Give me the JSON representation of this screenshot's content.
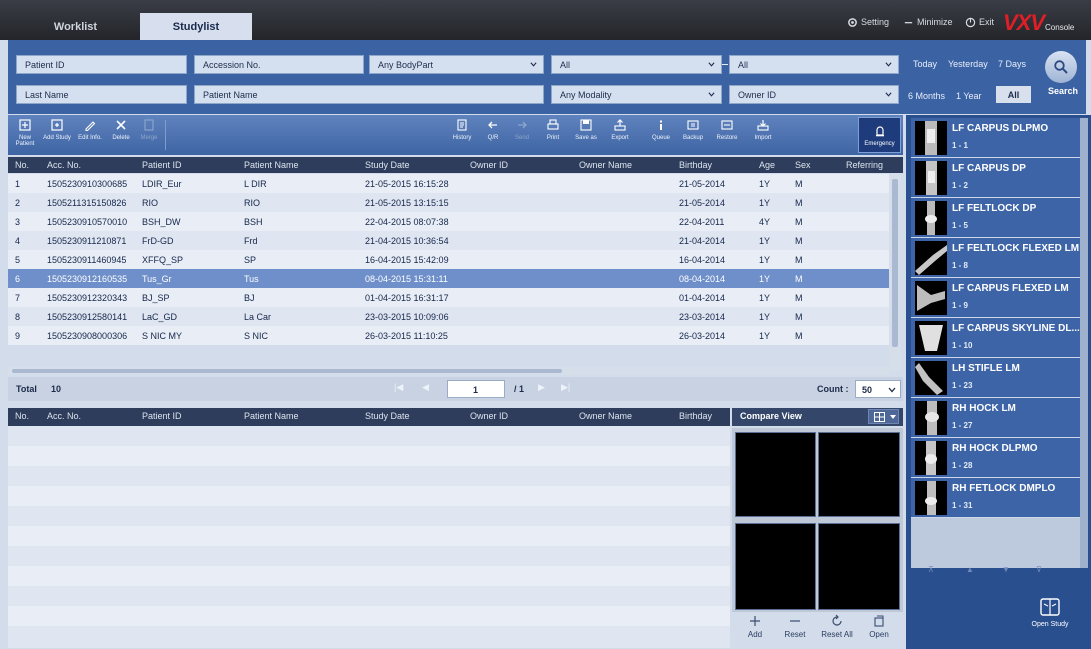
{
  "tabs": {
    "worklist": "Worklist",
    "studylist": "Studylist"
  },
  "topbar": {
    "setting": "Setting",
    "minimize": "Minimize",
    "exit": "Exit",
    "brand": "VXV",
    "brand_sub": "Console"
  },
  "search": {
    "patient_id": "Patient ID",
    "accession": "Accession No.",
    "bodypart": "Any BodyPart",
    "all1": "All",
    "all2": "All",
    "last_name": "Last Name",
    "patient_name": "Patient Name",
    "modality": "Any Modality",
    "owner_id": "Owner ID",
    "quick": [
      "Today",
      "Yesterday",
      "7 Days",
      "6 Months",
      "1 Year",
      "All"
    ],
    "search_label": "Search"
  },
  "toolbar": {
    "new_patient": "New Patient",
    "add_study": "Add Study",
    "edit_info": "Edit Info.",
    "delete": "Delete",
    "merge": "Merge",
    "history": "History",
    "qr": "Q/R",
    "send": "Send",
    "print": "Print",
    "save_as": "Save as",
    "export": "Export",
    "queue": "Queue",
    "backup": "Backup",
    "restore": "Restore",
    "import": "Import",
    "emergency": "Emergency"
  },
  "study_table": {
    "headers": {
      "no": "No.",
      "acc": "Acc. No.",
      "pid": "Patient ID",
      "pname": "Patient Name",
      "sdate": "Study Date",
      "owner_id": "Owner ID",
      "owner_name": "Owner Name",
      "birthday": "Birthday",
      "age": "Age",
      "sex": "Sex",
      "referring": "Referring"
    },
    "rows": [
      {
        "no": "1",
        "acc": "1505230910300685",
        "pid": "LDIR_Eur",
        "pname": "L DIR",
        "sdate": "21-05-2015 16:15:28",
        "birthday": "21-05-2014",
        "age": "1Y",
        "sex": "M"
      },
      {
        "no": "2",
        "acc": "1505211315150826",
        "pid": "RIO",
        "pname": "RIO",
        "sdate": "21-05-2015 13:15:15",
        "birthday": "21-05-2014",
        "age": "1Y",
        "sex": "M"
      },
      {
        "no": "3",
        "acc": "1505230910570010",
        "pid": "BSH_DW",
        "pname": "BSH",
        "sdate": "22-04-2015 08:07:38",
        "birthday": "22-04-2011",
        "age": "4Y",
        "sex": "M"
      },
      {
        "no": "4",
        "acc": "1505230911210871",
        "pid": "FrD-GD",
        "pname": "Frd",
        "sdate": "21-04-2015 10:36:54",
        "birthday": "21-04-2014",
        "age": "1Y",
        "sex": "M"
      },
      {
        "no": "5",
        "acc": "1505230911460945",
        "pid": "XFFQ_SP",
        "pname": "SP",
        "sdate": "16-04-2015 15:42:09",
        "birthday": "16-04-2014",
        "age": "1Y",
        "sex": "M"
      },
      {
        "no": "6",
        "acc": "1505230912160535",
        "pid": "Tus_Gr",
        "pname": "Tus",
        "sdate": "08-04-2015 15:31:11",
        "birthday": "08-04-2014",
        "age": "1Y",
        "sex": "M"
      },
      {
        "no": "7",
        "acc": "1505230912320343",
        "pid": "BJ_SP",
        "pname": "BJ",
        "sdate": "01-04-2015 16:31:17",
        "birthday": "01-04-2014",
        "age": "1Y",
        "sex": "M"
      },
      {
        "no": "8",
        "acc": "1505230912580141",
        "pid": "LaC_GD",
        "pname": "La Car",
        "sdate": "23-03-2015 10:09:06",
        "birthday": "23-03-2014",
        "age": "1Y",
        "sex": "M"
      },
      {
        "no": "9",
        "acc": "1505230908000306",
        "pid": "S NIC MY",
        "pname": "S NIC",
        "sdate": "26-03-2015 11:10:25",
        "birthday": "26-03-2014",
        "age": "1Y",
        "sex": "M"
      }
    ]
  },
  "pager": {
    "total_label": "Total",
    "total": "10",
    "page": "1",
    "of": "/ 1",
    "count_label": "Count :",
    "count": "50"
  },
  "lower_table": {
    "headers": {
      "no": "No.",
      "acc": "Acc. No.",
      "pid": "Patient ID",
      "pname": "Patient Name",
      "sdate": "Study Date",
      "owner_id": "Owner ID",
      "owner_name": "Owner Name",
      "birthday": "Birthday"
    }
  },
  "compare": {
    "title": "Compare View",
    "add": "Add",
    "reset": "Reset",
    "reset_all": "Reset All",
    "open": "Open"
  },
  "series": [
    {
      "title": "LF CARPUS DLPMO",
      "sub": "1 - 1"
    },
    {
      "title": "LF CARPUS DP",
      "sub": "1 - 2"
    },
    {
      "title": "LF FELTLOCK DP",
      "sub": "1 - 5"
    },
    {
      "title": "LF FELTLOCK FLEXED LM",
      "sub": "1 - 8"
    },
    {
      "title": "LF CARPUS FLEXED LM",
      "sub": "1 - 9"
    },
    {
      "title": "LF CARPUS SKYLINE DL...",
      "sub": "1 - 10"
    },
    {
      "title": "LH STIFLE LM",
      "sub": "1 - 23"
    },
    {
      "title": "RH HOCK LM",
      "sub": "1 - 27"
    },
    {
      "title": "RH HOCK DLPMO",
      "sub": "1 - 28"
    },
    {
      "title": "RH FETLOCK DMPLO",
      "sub": "1 - 31"
    }
  ],
  "open_study": "Open Study"
}
